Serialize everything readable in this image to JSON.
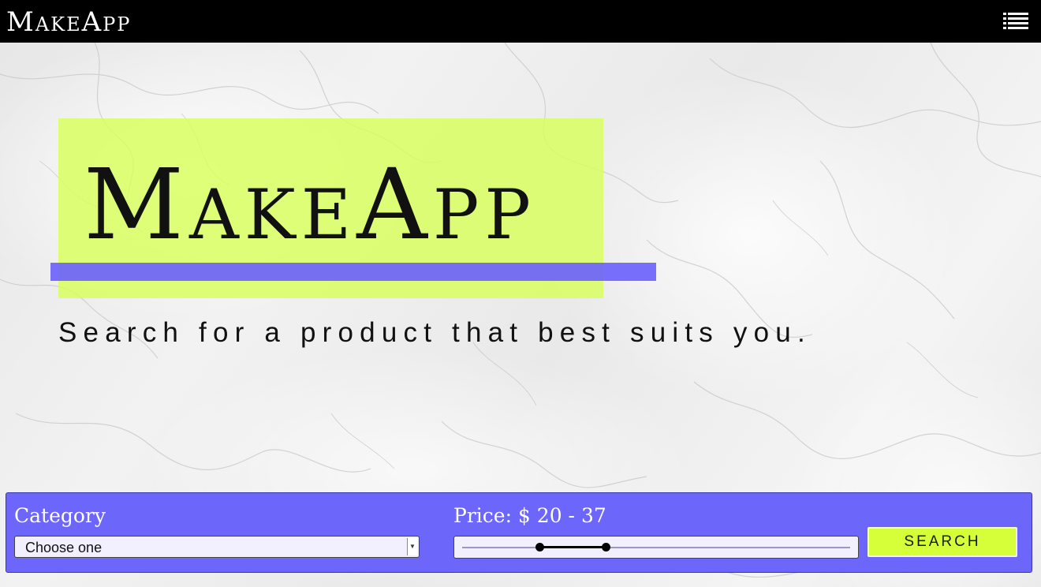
{
  "header": {
    "brand": "MakeApp",
    "menu_icon": "list-icon"
  },
  "hero": {
    "title": "MakeApp",
    "tagline": "Search for a product that best suits you."
  },
  "search": {
    "category_label": "Category",
    "category_selected": "Choose one",
    "price_label": "Price: $ 20 - 37",
    "price_min": 20,
    "price_max": 37,
    "range_min": 0,
    "range_max": 100,
    "button_label": "SEARCH"
  },
  "colors": {
    "topbar": "#000000",
    "highlight": "#d8ff5a",
    "accent": "#6d66fb",
    "button": "#d6ff3a"
  }
}
